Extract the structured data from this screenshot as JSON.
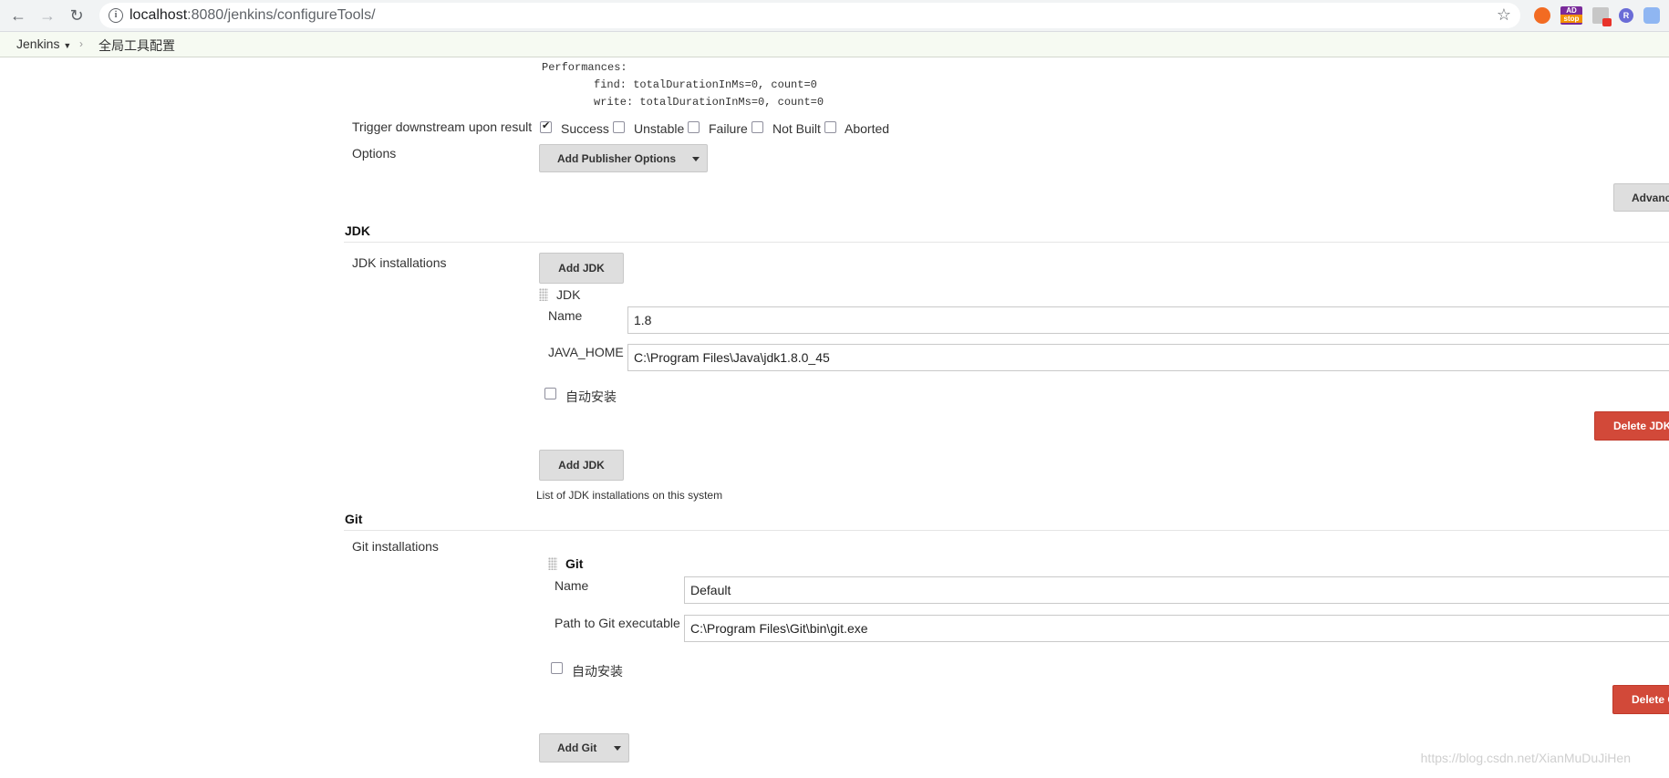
{
  "browser": {
    "url_host": "localhost",
    "url_path": ":8080/jenkins/configureTools/",
    "ext_stop_label_top": "AD",
    "ext_stop_label_bottom": "stop",
    "ext_r_label": "R"
  },
  "breadcrumb": {
    "home": "Jenkins",
    "current": "全局工具配置"
  },
  "performances": {
    "title": "Performances:",
    "find": "find: totalDurationInMs=0, count=0",
    "write": "write: totalDurationInMs=0, count=0"
  },
  "trigger": {
    "label": "Trigger downstream upon result",
    "options": [
      {
        "label": "Success",
        "checked": true
      },
      {
        "label": "Unstable",
        "checked": false
      },
      {
        "label": "Failure",
        "checked": false
      },
      {
        "label": "Not Built",
        "checked": false
      },
      {
        "label": "Aborted",
        "checked": false
      }
    ]
  },
  "options": {
    "label": "Options",
    "add_publisher_button": "Add Publisher Options",
    "advanced_button": "Advanc"
  },
  "jdk": {
    "section_title": "JDK",
    "installations_label": "JDK installations",
    "add_button": "Add JDK",
    "item_title": "JDK",
    "name_label": "Name",
    "name_value": "1.8",
    "home_label": "JAVA_HOME",
    "home_value": "C:\\Program Files\\Java\\jdk1.8.0_45",
    "auto_install_label": "自动安装",
    "delete_button": "Delete JDK",
    "add_button_bottom": "Add JDK",
    "help_text": "List of JDK installations on this system"
  },
  "git": {
    "section_title": "Git",
    "installations_label": "Git installations",
    "item_title": "Git",
    "name_label": "Name",
    "name_value": "Default",
    "path_label": "Path to Git executable",
    "path_value": "C:\\Program Files\\Git\\bin\\git.exe",
    "auto_install_label": "自动安装",
    "delete_button": "Delete Git",
    "add_button": "Add Git"
  },
  "watermark": "https://blog.csdn.net/XianMuDuJiHen",
  "colors": {
    "delete_red": "#d24939",
    "button_gray": "#dedede",
    "breadcrumb_bg": "#f6faf2"
  }
}
